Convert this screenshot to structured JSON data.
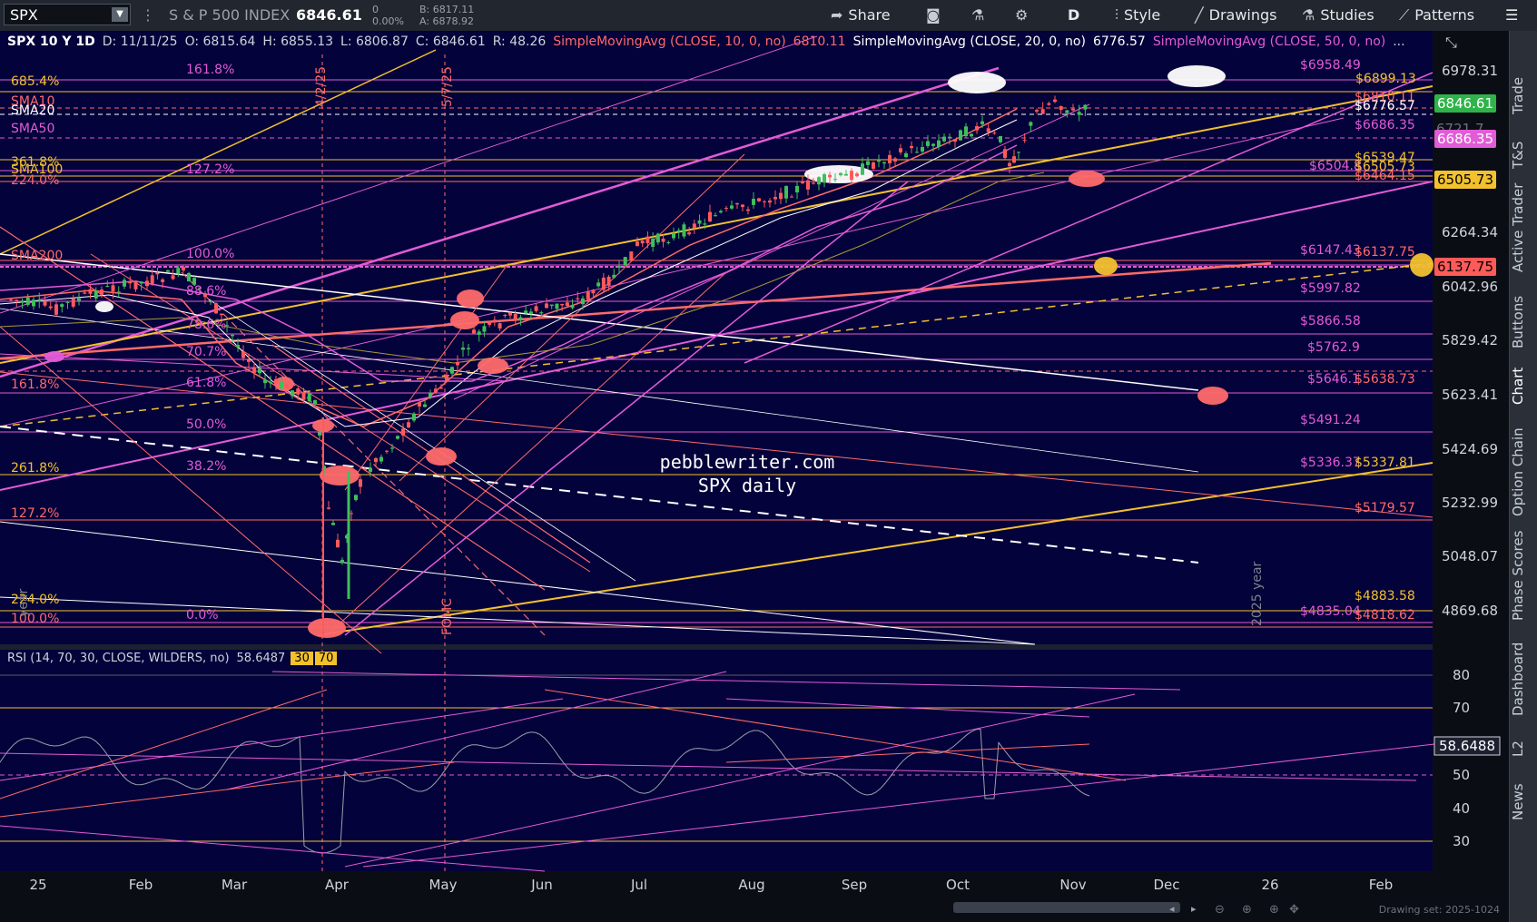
{
  "toolbar": {
    "symbol": "SPX",
    "index_name": "S & P 500 INDEX",
    "last_price": "6846.61",
    "change": "0",
    "change_pct": "0.00%",
    "bid": "B: 6817.11",
    "ask": "A: 6878.92",
    "share": "Share",
    "period": "D",
    "style": "Style",
    "drawings": "Drawings",
    "studies": "Studies",
    "patterns": "Patterns"
  },
  "header": {
    "title": "SPX 10 Y 1D",
    "date": "D: 11/11/25",
    "open": "O: 6815.64",
    "high": "H: 6855.13",
    "low": "L: 6806.87",
    "close": "C: 6846.61",
    "range": "R: 48.26",
    "sma10": "SimpleMovingAvg (CLOSE, 10, 0, no)",
    "sma10_val": "6810.11",
    "sma20": "SimpleMovingAvg (CLOSE, 20, 0, no)",
    "sma20_val": "6776.57",
    "sma50": "SimpleMovingAvg (CLOSE, 50, 0, no)",
    "more": "..."
  },
  "rsi_header": {
    "label": "RSI (14, 70, 30, CLOSE, WILDERS, no)",
    "value": "58.6487",
    "ob": "30",
    "os": "70"
  },
  "right_sidebar": [
    "Trade",
    "T&S",
    "Active Trader",
    "Buttons",
    "Chart",
    "Option Chain",
    "Phase Scores",
    "Dashboard",
    "L2",
    "News"
  ],
  "watermark": {
    "line1": "pebblewriter.com",
    "line2": "SPX daily"
  },
  "price_axis": {
    "ticks": [
      "6978.31",
      "6264.34",
      "6042.96",
      "5829.42",
      "5623.41",
      "5424.69",
      "5232.99",
      "5048.07",
      "4869.68"
    ],
    "tags": [
      {
        "text": "6846.61",
        "bg": "#2fb34a",
        "fg": "#ffffff"
      },
      {
        "text": "6686.35",
        "bg": "#e25bd7",
        "fg": "#ffffff"
      },
      {
        "text": "6505.73",
        "bg": "#f2c12e",
        "fg": "#000000"
      },
      {
        "text": "6137.75",
        "bg": "#ff5a5a",
        "fg": "#000000"
      }
    ],
    "partial_tick": "6721.7"
  },
  "rsi_axis": {
    "ticks": [
      "80",
      "70",
      "50",
      "40",
      "30"
    ],
    "tag": "58.6488"
  },
  "time_axis": [
    "25",
    "Feb",
    "Mar",
    "Apr",
    "May",
    "Jun",
    "Jul",
    "Aug",
    "Sep",
    "Oct",
    "Nov",
    "Dec",
    "26",
    "Feb"
  ],
  "footer": {
    "drawing_set": "Drawing set: 2025-1024"
  },
  "level_labels": {
    "right": [
      {
        "text": "$6958.49",
        "color": "#e25bd7"
      },
      {
        "text": "$6899.13",
        "color": "#f2c12e"
      },
      {
        "text": "$6810.11",
        "color": "#ff6a6a"
      },
      {
        "text": "$6776.57",
        "color": "#ffffff"
      },
      {
        "text": "$6686.35",
        "color": "#e25bd7"
      },
      {
        "text": "$6539.47",
        "color": "#f2c12e"
      },
      {
        "text": "$6504.8",
        "color": "#e25bd7"
      },
      {
        "text": "$6505.73",
        "color": "#f2c12e"
      },
      {
        "text": "$6464.15",
        "color": "#ff6a6a"
      },
      {
        "text": "$6147.43",
        "color": "#e25bd7"
      },
      {
        "text": "$6137.75",
        "color": "#ff6a6a"
      },
      {
        "text": "$5997.82",
        "color": "#e25bd7"
      },
      {
        "text": "$5866.58",
        "color": "#e25bd7"
      },
      {
        "text": "$5762.9",
        "color": "#e25bd7"
      },
      {
        "text": "$5646.1",
        "color": "#e25bd7"
      },
      {
        "text": "$5638.73",
        "color": "#ff6a6a"
      },
      {
        "text": "$5491.24",
        "color": "#e25bd7"
      },
      {
        "text": "$5336.37",
        "color": "#e25bd7"
      },
      {
        "text": "$5337.81",
        "color": "#f2c12e"
      },
      {
        "text": "$5179.57",
        "color": "#ff6a6a"
      },
      {
        "text": "$4883.58",
        "color": "#f2c12e"
      },
      {
        "text": "$4835.04",
        "color": "#e25bd7"
      },
      {
        "text": "$4818.62",
        "color": "#ff6a6a"
      }
    ],
    "left": [
      {
        "text": "685.4%",
        "color": "#f2c12e"
      },
      {
        "text": "SMA10",
        "color": "#ff6a6a"
      },
      {
        "text": "SMA20",
        "color": "#ffffff"
      },
      {
        "text": "SMA50",
        "color": "#e25bd7"
      },
      {
        "text": "361.8%",
        "color": "#f2c12e"
      },
      {
        "text": "SMA100",
        "color": "#f2c12e"
      },
      {
        "text": "224.0%",
        "color": "#ff6a6a"
      },
      {
        "text": "SMA200",
        "color": "#ff6a6a"
      },
      {
        "text": "161.8%",
        "color": "#ff6a6a"
      },
      {
        "text": "261.8%",
        "color": "#f2c12e"
      },
      {
        "text": "127.2%",
        "color": "#ff6a6a"
      },
      {
        "text": "224.0%",
        "color": "#f2c12e"
      },
      {
        "text": "100.0%",
        "color": "#ff6a6a"
      }
    ],
    "fib": [
      {
        "text": "161.8%",
        "color": "#e25bd7"
      },
      {
        "text": "127.2%",
        "color": "#e25bd7"
      },
      {
        "text": "100.0%",
        "color": "#e25bd7"
      },
      {
        "text": "88.6%",
        "color": "#e25bd7"
      },
      {
        "text": "78.6%",
        "color": "#e25bd7"
      },
      {
        "text": "70.7%",
        "color": "#e25bd7"
      },
      {
        "text": "61.8%",
        "color": "#e25bd7"
      },
      {
        "text": "50.0%",
        "color": "#e25bd7"
      },
      {
        "text": "38.2%",
        "color": "#e25bd7"
      },
      {
        "text": "0.0%",
        "color": "#e25bd7"
      }
    ],
    "vertical": [
      {
        "text": "4/2/25",
        "color": "#ff6a6a"
      },
      {
        "text": "5/7/25",
        "color": "#ff6a6a"
      },
      {
        "text": "FOMC",
        "color": "#ff6a6a"
      },
      {
        "text": "2025 year",
        "color": "#7d828c"
      },
      {
        "text": "year",
        "color": "#7d828c"
      }
    ]
  },
  "colors": {
    "bg": "#04023a",
    "pink": "#e25bd7",
    "gold": "#f2c12e",
    "salmon": "#ff6a6a",
    "white": "#ffffff",
    "green": "#2fb34a"
  }
}
